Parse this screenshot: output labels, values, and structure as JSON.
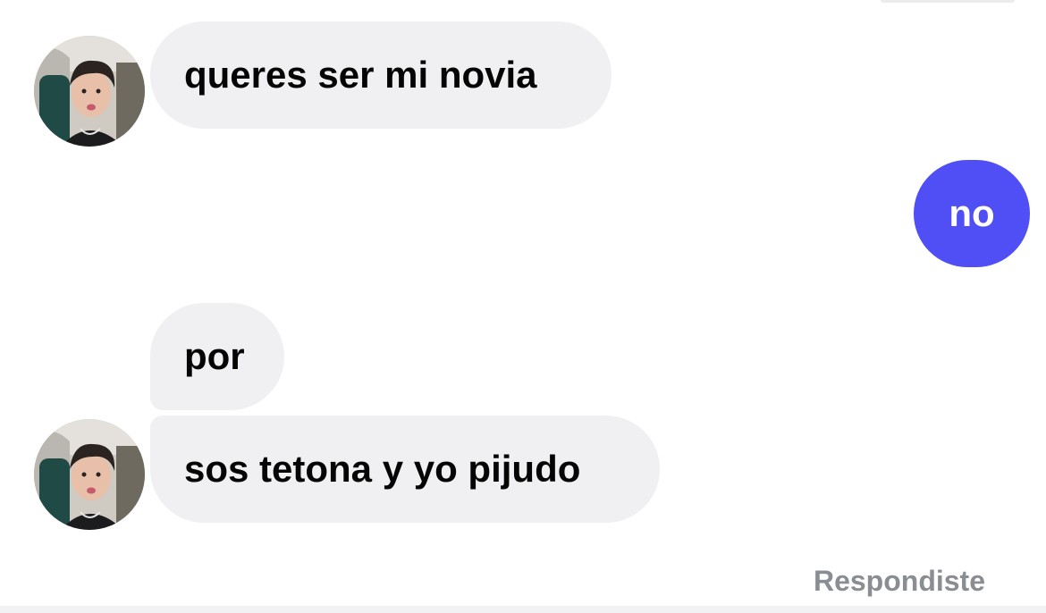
{
  "conversation": {
    "messages": [
      {
        "sender": "contact",
        "text": "queres ser mi novia",
        "avatar": "profile-photo"
      },
      {
        "sender": "me",
        "text": "no"
      },
      {
        "sender": "contact",
        "text": "por"
      },
      {
        "sender": "contact",
        "text": "sos tetona y yo pijudo",
        "avatar": "profile-photo"
      }
    ],
    "status": "Respondiste"
  },
  "colors": {
    "incoming_bubble": "#f0f0f2",
    "outgoing_bubble": "#4f4ff5",
    "status_text": "#8a8d91"
  }
}
